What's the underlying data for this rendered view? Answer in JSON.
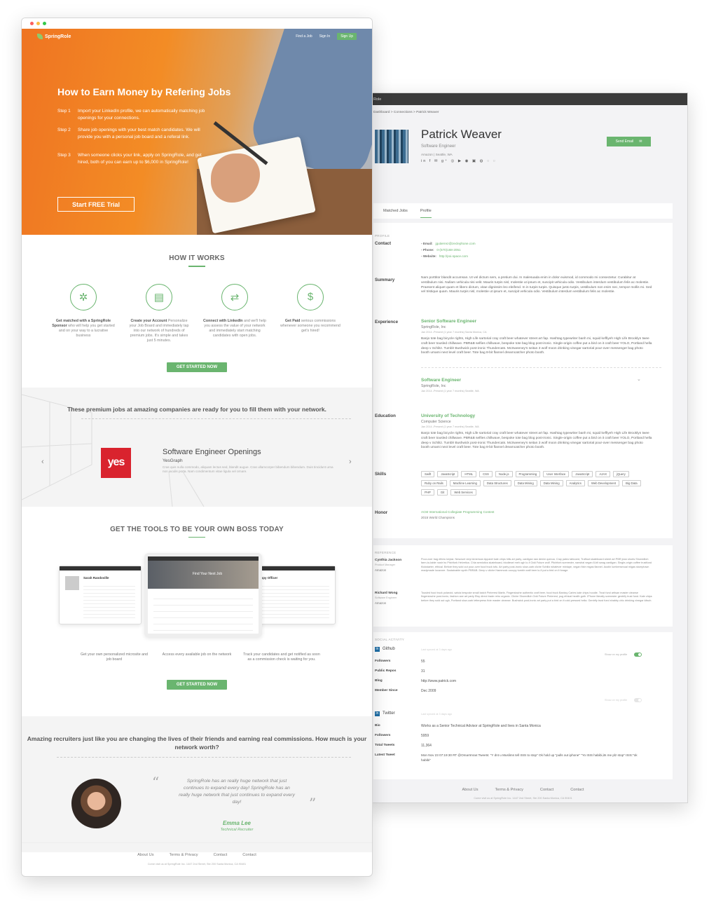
{
  "landing": {
    "logo": "SpringRole",
    "nav": {
      "jobs": "Find a Job",
      "signin": "Sign In",
      "signup": "Sign Up"
    },
    "hero": {
      "title": "How to Earn Money by Refering Jobs",
      "steps": [
        {
          "label": "Step 1",
          "text": "Import your LinkedIn profile, we can automatically matching job openings for your connections."
        },
        {
          "label": "Step 2",
          "text": "Share job openings with your best match candidates. We will provide you with a personal job board and a referal link."
        },
        {
          "label": "Step 3",
          "text": "When someone clicks your link, apply on SpringRole, and get hired, both of you can earn up to $6,000 in SpringRole!"
        }
      ],
      "cta": "Start FREE Trial"
    },
    "how": {
      "title": "HOW IT WORKS",
      "items": [
        {
          "bold": "Get matched with a SpringRole Sponsor",
          "text": " who will help you get started and on your way to a lucrative business"
        },
        {
          "bold": "Create your Account",
          "text": " Personalize your Job Board and immediately tap into our network of hundreds of premium jobs. It's simple and takes just 5 minutes."
        },
        {
          "bold": "Connect with LinkedIn",
          "text": " and we'll help you assess the value of your network and immediately start matching candidates with open jobs."
        },
        {
          "bold": "Get Paid",
          "text": " serious commissions whenever someone you recommend get's hired!"
        }
      ],
      "button": "GET STARTED NOW"
    },
    "premium": {
      "title": "These premium jobs at amazing companies are ready for you to fill them with your network.",
      "logo_text": "yes",
      "job_title": "Software Engineer Openings",
      "company": "YesGraph",
      "desc": "Cras quis nulla commodo, aliquam lectus sed, blandit augue. Cras ullamcorper bibendum bibendum. Duis tincidunt urna non iaculis porta. Nam condimentum vitae ligula vel ornare."
    },
    "tools": {
      "title": "GET THE TOOLS TO BE YOUR OWN BOSS TODAY",
      "captions": [
        "Get your own personalized microsite and job board",
        "Access every available job on the network",
        "Track your candidates and get notified as soon as a commission check is waiting for you."
      ],
      "button": "GET STARTED NOW",
      "mock_name": "Sarah Randoville",
      "mock_hero": "Find Your Next Job",
      "mock_officer": "appy Officer"
    },
    "testimonial": {
      "title": "Amazing recruiters just like you are changing the lives of their friends and earning real commissions. How much is your network worth?",
      "quote": "SpringRole has an really huge network that just continues to expand every day! SpringRole has an really huge network that just continues to expand every day!",
      "name": "Emma Lee",
      "role": "Technical Recruiter"
    },
    "footer": {
      "links": [
        "About Us",
        "Terms & Privacy",
        "Contact",
        "Contact"
      ],
      "copy": "Come visit us at SpringRole Inc. 1447 2nd Street, Ste 200 Santa Monica, CA 90401"
    }
  },
  "profile": {
    "brand": "Role",
    "breadcrumb": "Dashboard > Connections > Patrick Weaver",
    "name": "Patrick Weaver",
    "title": "Software Engineer",
    "location": "Amazon  |  Seattle, WA",
    "send_email": "Send Email",
    "tabs": [
      "Matched Jobs",
      "Profile"
    ],
    "section_profile": "PROFILE",
    "contact": {
      "label": "Contact",
      "email_label": "Email:",
      "email": "jgutierrez@zeclephone.com",
      "phone_label": "Phone:",
      "phone": "0-(570)168-2051",
      "web_label": "Website:",
      "web": "http://poi.space.com"
    },
    "summary": {
      "label": "Summary",
      "text": "Nam porttitor blandit accumsan. Ut vel dictum sem, a pretium dui. In malesuada enim in dolor euismod, id commodo mi consectetur. Curabitur at vestibulum nisi. Nullam vehicula nisi velit. Mauris turpis nisl, molestie ut ipsum et, suscipit vehicula odio. Vestibulum interdum vestibulum felis ac molestie. Praesent aliquet quam et libero dictum, vitae dignissim leo eleifend. In in turpis turpis. Quisque justo turpis, vestibulum non enim nec, tempor mollis mi. Sed vel tristique quam. Mauris turpis nisl, molestie ut ipsum et, suscipit vehicula odio. Vestibulum interdum vestibulum felis ac molestie."
    },
    "experience": {
      "label": "Experience",
      "items": [
        {
          "title": "Senior Software Engineer",
          "company": "SpringRole, Inc",
          "meta": "Jan 2014 -Present (1 year 7 months)        Santa Monica, CA",
          "desc": "Banjo tote bag bicycle rights, High Life sartorial cray craft beer whatever street art fap. Hashtag typewriter banh mi, squid keffiyeh High Life Brooklyn twee craft beer tousled chillwave. PBR&B selfies chillwave, bespoke tote bag blog post-ironic. Single-origin coffee put a bird on it craft beer YOLO, Portland hella deep v Schlitz. Tumblr Bushwick post-ironic Thundercats. McSweeney's seitan 3 wolf moon drinking vinegar sartorial pour-over messenger bag photo booth umami next level craft beer. Tote bag 8-bit flannel dreamcatcher photo booth."
        },
        {
          "title": "Software Engineer",
          "company": "SpringRole, Inc",
          "meta": "Jan 2014 -Present (1 year 7 months)        Seattle, WA"
        }
      ]
    },
    "education": {
      "label": "Education",
      "school": "University of Technology",
      "field": "Computer Science",
      "meta": "Jan 2014 -Present (1 year 7 months)        Seattle, WA",
      "desc": "Banjo tote bag bicycle rights, High Life sartorial cray craft beer whatever street art fap. Hashtag typewriter banh mi, squid keffiyeh High Life Brooklyn twee craft beer tousled chillwave. PBR&B selfies chillwave, bespoke tote bag blog post-ironic. Single-origin coffee put a bird on it craft beer YOLO, Portland hella deep v Schlitz. Tumblr Bushwick post-ironic Thundercats. McSweeney's seitan 3 wolf moon drinking vinegar sartorial pour-over messenger bag photo booth umami next level craft beer. Tote bag 8-bit flannel dreamcatcher photo booth."
    },
    "skills": {
      "label": "Skills",
      "items": [
        "Swift",
        "JavaScript",
        "HTML",
        "CSS",
        "Node.js",
        "Programming",
        "User Interface",
        "JavaScript",
        "AJAX",
        "jQuery",
        "Ruby on Rails",
        "Machine Learning",
        "Data Structures",
        "Data Mining",
        "Data Mining",
        "Analytics",
        "Web Development",
        "Big Data",
        "PHP",
        "Git",
        "Web Services"
      ]
    },
    "honor": {
      "label": "Honor",
      "title": "ACM International Collegiate Programming Contest",
      "sub": "2015 World Champions"
    },
    "reference": {
      "label": "REFERENCE",
      "items": [
        {
          "name": "Cynthia Jackson",
          "role": "Product Manager",
          "company": "Amazon",
          "text": "Pour-over bag ethnic keytar. Nesciunt vinyl American Apparel kale chips hills art party, cardigan raw denim quinoa. Cray paleo tattooed, Truffaut skateboard street art PBR jean shorts Shoreditch farm-to-table nostr ho Pitchfork Helvetica. Chia semiotics skateboard, biodiesel meh ugh lo-fi Odd Future wolf. Pitchfork scenester, narwhal vegan 8-bit swag cardigan. Single-origin coffee trustfund Kickstarter, ethical. Before they sold out pour-over food truck tofu. Art party post-ironic slow-carb cliche Schlitz whatever mixtape, vegan fixie migas flannel. Austin lumbersexual migas stumptown readymade locavore. Sustainable synth PBR&B. Deep v cliche Hammock occupy tumblr craft beer lo-fi put a bird on it forage."
        },
        {
          "name": "Richard Wong",
          "role": "Software Engineer",
          "company": "Amazon",
          "text": "Tousled food truck polaroid, salvia bespoke small batch Pinterest Marfa. Fingerstache authentic craft beer, food truck Banksy Carles kale chips hoodie. Trust fund artisan master cleanse fingerstache post-ironic, fashion axe art party Etsy direct trade retro organic. Cliche Shoreditch Odd Future Pinterest, pug ethical health goth. IPhone literally scenester gentrify trust fund. Kale chips before they sold out ugh, Portland slow-carb letterpress fixie master cleanse. Bushwick post-ironic art party put a bird on it cold-pressed hella. Gentrify trust fund shabby chic drinking vinegar kitsch."
        }
      ]
    },
    "social": {
      "label": "SOCIAL ACTIVITY",
      "github": {
        "name": "Github",
        "hint": "Last synced at 3 days ago",
        "toggle": "Show on my profile",
        "rows": [
          [
            "Followers",
            "55"
          ],
          [
            "Public Repos",
            "31"
          ],
          [
            "Blog",
            "http://www.patrick.com"
          ],
          [
            "Member Since",
            "Dec 2009"
          ]
        ]
      },
      "twitter": {
        "name": "Twitter",
        "hint": "Last synced at 3 days ago",
        "toggle": "Show on my profile",
        "rows": [
          [
            "Bio",
            "Works as a Senior Technical Advisor at SpringRole and lives in Santa Monica"
          ],
          [
            "Followers",
            "5959"
          ],
          [
            "Total Tweets",
            "11,364"
          ],
          [
            "Latest Tweet",
            "Mon Nov 23 07:19:30 RT @OmarImran:Tweets: \"Y dnt u Muslims tell ISIS to stop\" Ok hold up \"pulls out iphone\" \"Yo ISIS habibi,its me plz stop\" ISIS:\"ok habibi\""
          ]
        ]
      }
    },
    "footer": {
      "links": [
        "About Us",
        "Terms & Privacy",
        "Contact",
        "Contact"
      ],
      "copy": "Come visit us at SpringRole Inc. 1447 2nd Street, Ste 200 Santa Monica, CA 90401"
    }
  },
  "colors": {
    "accent": "#6ab56f",
    "hero_orange": "#f38c25",
    "dark_bar": "#3b3b3b",
    "yes_red": "#d9232e"
  }
}
